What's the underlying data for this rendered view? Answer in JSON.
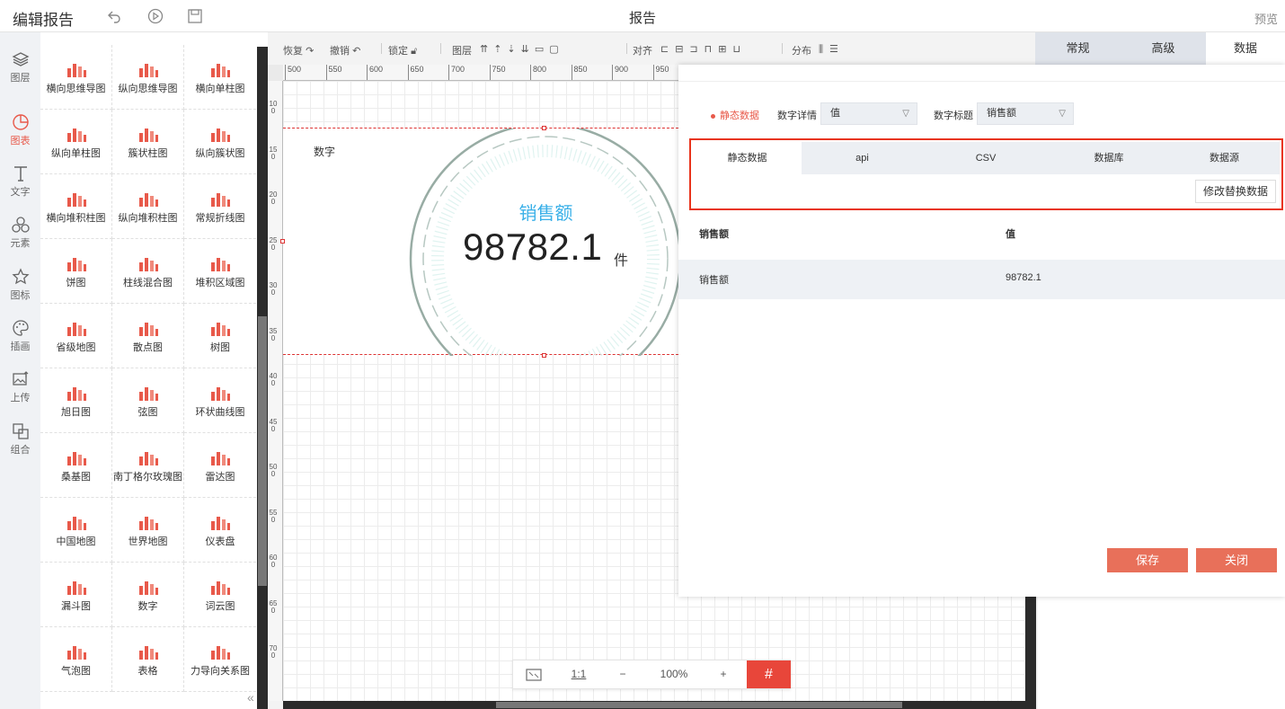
{
  "topbar": {
    "title": "编辑报告",
    "center_title": "报告",
    "preview": "预览",
    "icons": [
      "undo-icon",
      "play-icon",
      "save-icon"
    ]
  },
  "leftnav": [
    {
      "label": "图层",
      "icon": "layers-icon"
    },
    {
      "label": "图表",
      "icon": "chart-icon",
      "active": true
    },
    {
      "label": "文字",
      "icon": "text-icon"
    },
    {
      "label": "元素",
      "icon": "elements-icon"
    },
    {
      "label": "图标",
      "icon": "star-icon"
    },
    {
      "label": "插画",
      "icon": "palette-icon"
    },
    {
      "label": "上传",
      "icon": "upload-image-icon"
    },
    {
      "label": "组合",
      "icon": "group-icon"
    }
  ],
  "components": [
    "横向思维导图",
    "纵向思维导图",
    "横向单柱图",
    "纵向单柱图",
    "簇状柱图",
    "纵向簇状图",
    "横向堆积柱图",
    "纵向堆积柱图",
    "常规折线图",
    "饼图",
    "柱线混合图",
    "堆积区域图",
    "省级地图",
    "散点图",
    "树图",
    "旭日图",
    "弦图",
    "环状曲线图",
    "桑基图",
    "南丁格尔玫瑰图",
    "雷达图",
    "中国地图",
    "世界地图",
    "仪表盘",
    "漏斗图",
    "数字",
    "词云图",
    "气泡图",
    "表格",
    "力导向关系图"
  ],
  "toolbar": {
    "redo": "恢复",
    "undo": "撤销",
    "lock": "锁定",
    "layer": "图层",
    "align": "对齐",
    "distribute": "分布"
  },
  "ruler": {
    "h_ticks": [
      "500",
      "550",
      "600",
      "650",
      "700",
      "750",
      "800",
      "850",
      "900",
      "950"
    ],
    "v_ticks": [
      "100",
      "150",
      "200",
      "250",
      "300",
      "350",
      "400",
      "450",
      "500",
      "550",
      "600",
      "650",
      "700"
    ]
  },
  "widget": {
    "label": "数字",
    "metric_title": "销售额",
    "metric_value": "98782.1",
    "metric_unit": "件"
  },
  "zoombar": {
    "fit": "fit-screen-icon",
    "ratio": "1:1",
    "minus": "−",
    "zoom": "100%",
    "plus": "+",
    "grid": "#"
  },
  "prop_tabs": [
    "常规",
    "高级",
    "数据"
  ],
  "dialog": {
    "static_label": "静态数据",
    "detail_label": "数字详情",
    "detail_value": "值",
    "title_label": "数字标题",
    "title_value": "销售额",
    "src_tabs": [
      "静态数据",
      "api",
      "CSV",
      "数据库",
      "数据源"
    ],
    "modify_button": "修改替换数据",
    "table": {
      "headers": [
        "销售额",
        "值"
      ],
      "rows": [
        [
          "销售额",
          "98782.1"
        ]
      ]
    },
    "save": "保存",
    "close": "关闭"
  },
  "colors": {
    "accent": "#e8594a",
    "highlight": "#e8341c",
    "metric_title": "#3ab0e8",
    "button": "#e8705a"
  }
}
